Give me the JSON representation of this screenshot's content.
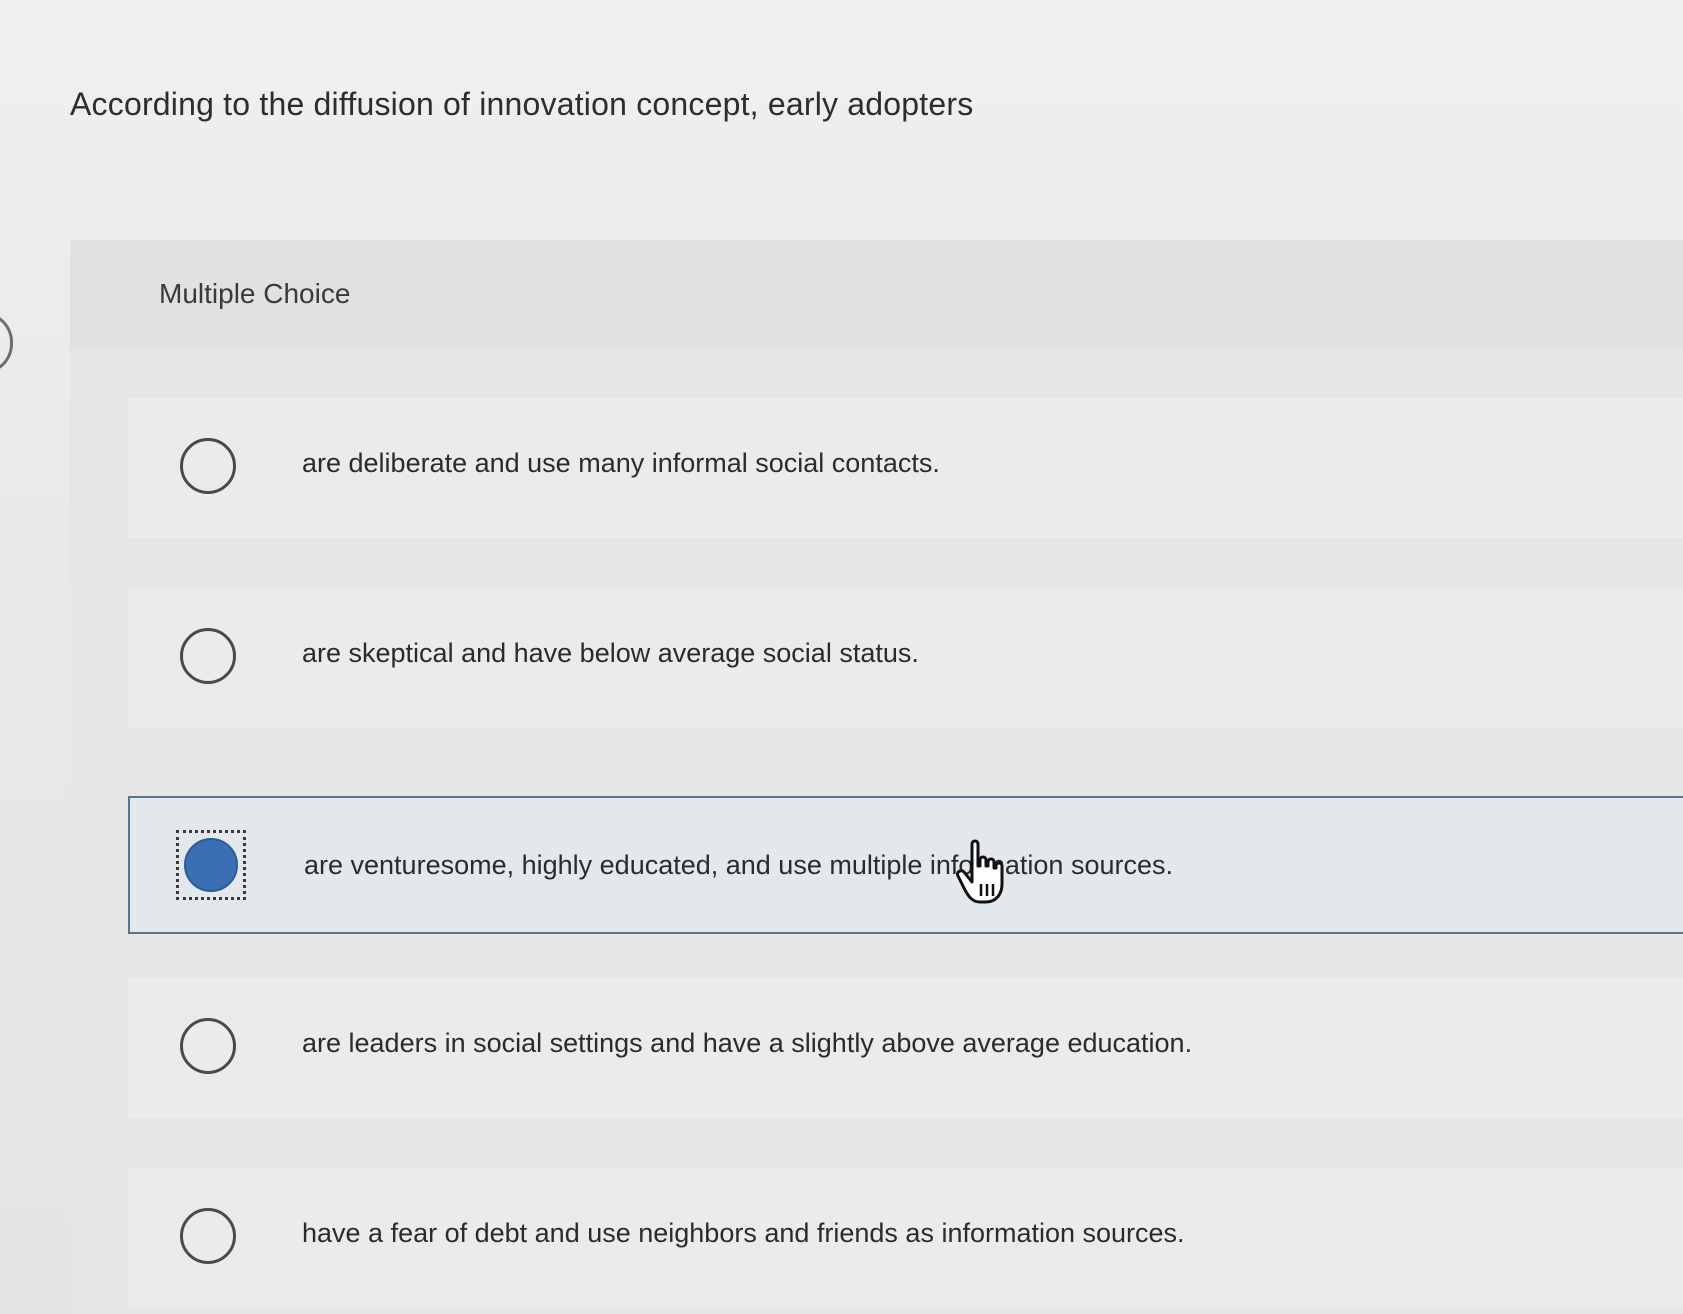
{
  "question": {
    "title": "According to the diffusion of innovation concept, early adopters",
    "type_label": "Multiple Choice"
  },
  "choices": [
    {
      "text": "are deliberate and use many informal social contacts.",
      "selected": false
    },
    {
      "text": "are skeptical and have below average social status.",
      "selected": false
    },
    {
      "text": "are venturesome, highly educated, and use multiple information sources.",
      "selected": true
    },
    {
      "text": "are leaders in social settings and have a slightly above average education.",
      "selected": false
    },
    {
      "text": "have a fear of debt and use neighbors and friends as information sources.",
      "selected": false
    }
  ],
  "colors": {
    "selected_fill": "#3a6fb3",
    "selected_border": "#5a7391",
    "selected_background": "#e3e8ec"
  },
  "pointer": {
    "icon": "hand-pointer-icon"
  }
}
